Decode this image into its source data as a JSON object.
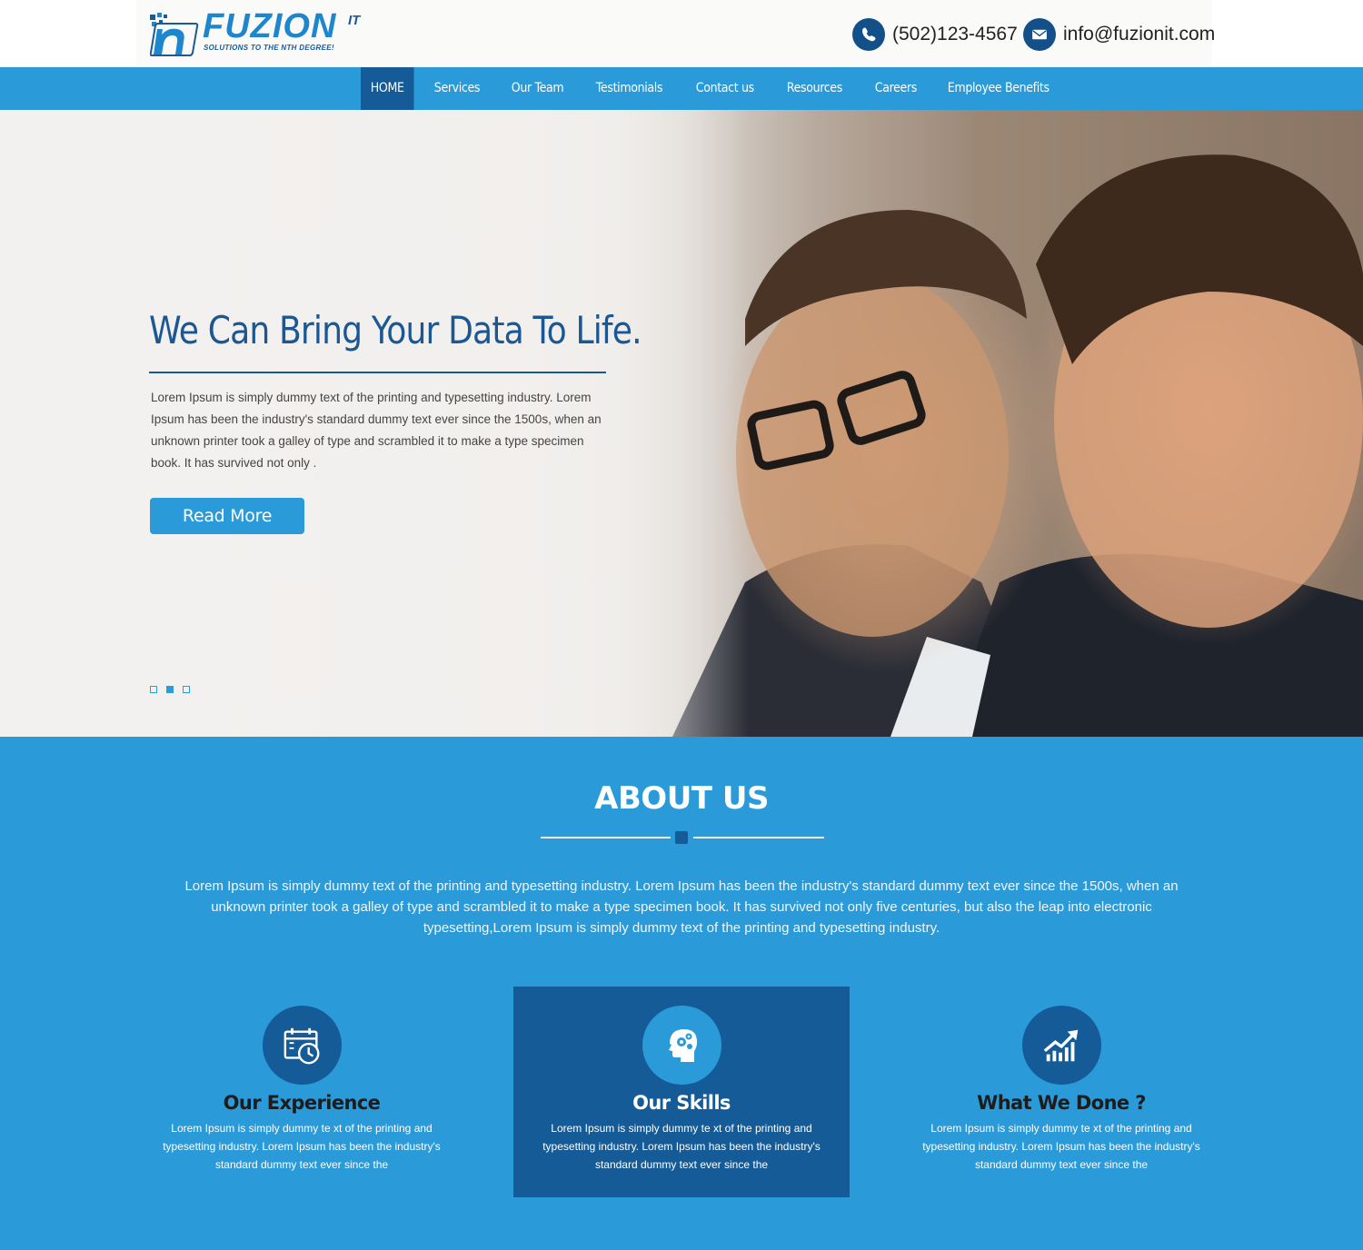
{
  "brand": {
    "name": "FUZION",
    "suffix": "IT",
    "tagline": "SOLUTIONS TO THE NTH DEGREE!",
    "primary_color": "#2b9ad9",
    "dark_color": "#155b97"
  },
  "contact": {
    "phone_icon": "phone-icon",
    "phone": "(502)123-4567",
    "email_icon": "envelope-icon",
    "email": "info@fuzionit.com"
  },
  "nav": {
    "items": [
      "HOME",
      "Services",
      "Our Team",
      "Testimonials",
      "Contact us",
      "Resources",
      "Careers",
      "Employee Benefits"
    ],
    "active": "HOME"
  },
  "hero": {
    "title": "We Can Bring Your Data To Life.",
    "text": "Lorem Ipsum is simply dummy text of the printing and typesetting industry. Lorem Ipsum has been the industry's standard dummy text ever since the 1500s, when an unknown printer took a galley of type and scrambled it to make a type specimen book. It has survived not only .",
    "button": "Read More",
    "slides": 3,
    "active_slide": 2
  },
  "about": {
    "title": "ABOUT US",
    "text": "Lorem Ipsum is simply dummy text of the printing and typesetting industry. Lorem Ipsum has been the industry's standard dummy text ever since the 1500s, when an unknown printer took a galley of type and scrambled it to make a type specimen book. It has survived not only five centuries, but also the leap into electronic typesetting,Lorem Ipsum is simply dummy text of the printing and typesetting industry.",
    "features": [
      {
        "icon": "calendar-clock-icon",
        "title": "Our Experience",
        "text": "Lorem Ipsum is simply dummy te xt of the printing and typesetting industry. Lorem  Ipsum has been the industry's standard dummy text ever since the"
      },
      {
        "icon": "head-gears-icon",
        "title": "Our Skills",
        "text": "Lorem Ipsum is simply dummy te xt of the printing and typesetting industry. Lorem  Ipsum has been the industry's standard dummy text ever since the"
      },
      {
        "icon": "growth-chart-icon",
        "title": "What We Done ?",
        "text": "Lorem Ipsum is simply dummy te xt of the printing and typesetting industry. Lorem  Ipsum has been the industry's standard dummy text ever since the"
      }
    ]
  }
}
